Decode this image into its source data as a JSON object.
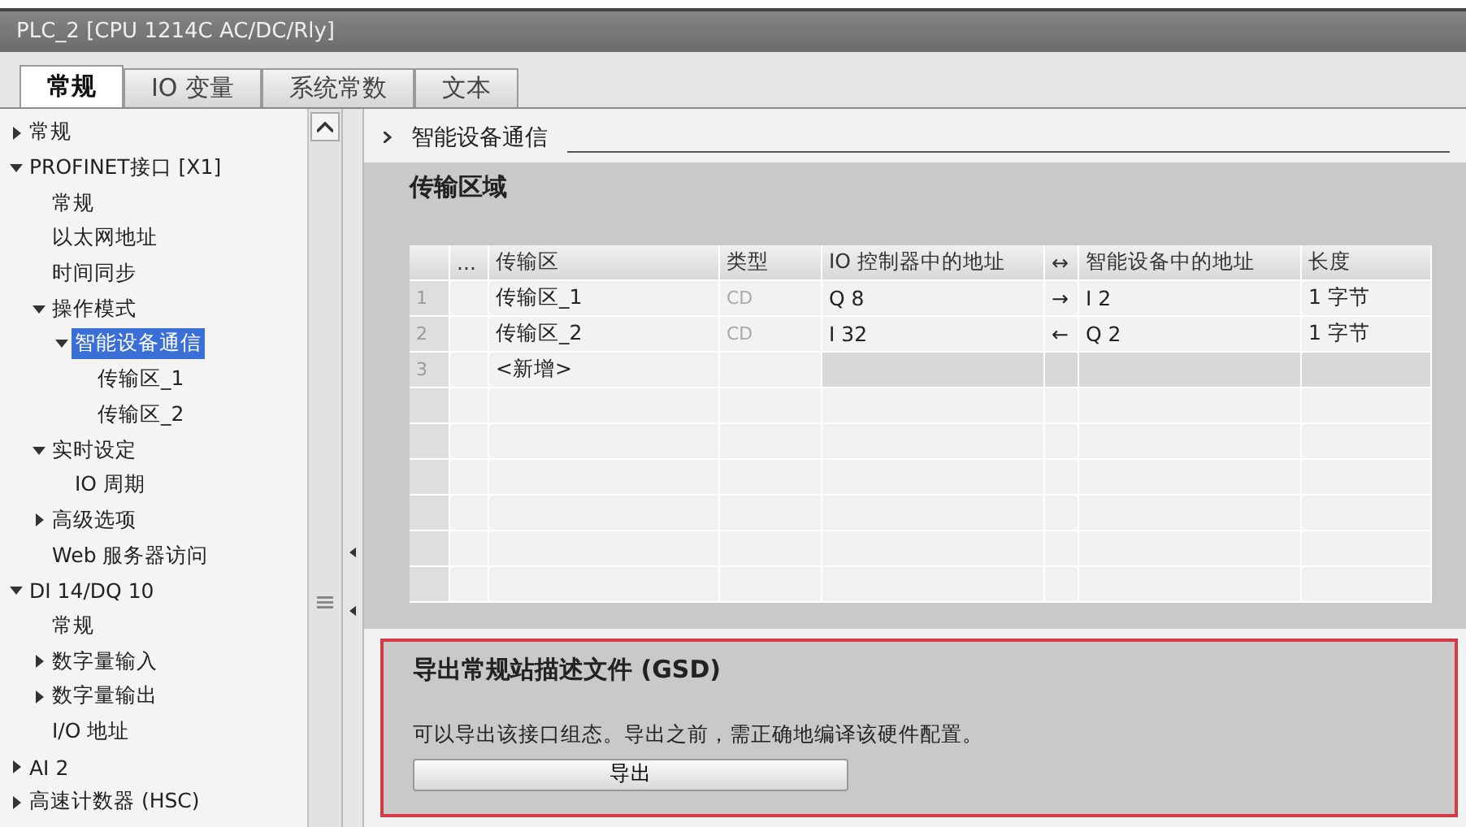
{
  "window": {
    "title": "PLC_2 [CPU 1214C AC/DC/Rly]"
  },
  "tabs": [
    {
      "label": "常规",
      "selected": true
    },
    {
      "label": "IO 变量",
      "selected": false
    },
    {
      "label": "系统常数",
      "selected": false
    },
    {
      "label": "文本",
      "selected": false
    }
  ],
  "sidebar": {
    "items": [
      {
        "label": "常规",
        "kind": "folder",
        "expanded": false,
        "selected": false
      },
      {
        "label": "PROFINET接口 [X1]",
        "kind": "folder",
        "expanded": true,
        "selected": false,
        "children": [
          {
            "label": "常规",
            "kind": "leaf",
            "selected": false
          },
          {
            "label": "以太网地址",
            "kind": "leaf",
            "selected": false
          },
          {
            "label": "时间同步",
            "kind": "leaf",
            "selected": false
          },
          {
            "label": "操作模式",
            "kind": "folder",
            "expanded": true,
            "selected": false,
            "children": [
              {
                "label": "智能设备通信",
                "kind": "folder",
                "expanded": true,
                "selected": true,
                "children": [
                  {
                    "label": "传输区_1",
                    "kind": "leaf",
                    "selected": false
                  },
                  {
                    "label": "传输区_2",
                    "kind": "leaf",
                    "selected": false
                  }
                ]
              }
            ]
          },
          {
            "label": "实时设定",
            "kind": "folder",
            "expanded": true,
            "selected": false,
            "children": [
              {
                "label": "IO 周期",
                "kind": "leaf",
                "selected": false
              }
            ]
          },
          {
            "label": "高级选项",
            "kind": "folder",
            "expanded": false,
            "selected": false
          },
          {
            "label": "Web 服务器访问",
            "kind": "leaf",
            "selected": false
          }
        ]
      },
      {
        "label": "DI 14/DQ 10",
        "kind": "folder",
        "expanded": true,
        "selected": false,
        "children": [
          {
            "label": "常规",
            "kind": "leaf",
            "selected": false
          },
          {
            "label": "数字量输入",
            "kind": "folder",
            "expanded": false,
            "selected": false
          },
          {
            "label": "数字量输出",
            "kind": "folder",
            "expanded": false,
            "selected": false
          },
          {
            "label": "I/O 地址",
            "kind": "leaf",
            "selected": false
          }
        ]
      },
      {
        "label": "AI 2",
        "kind": "folder",
        "expanded": false,
        "selected": false
      },
      {
        "label": "高速计数器 (HSC)",
        "kind": "folder",
        "expanded": false,
        "selected": false
      }
    ]
  },
  "section": {
    "title": "智能设备通信"
  },
  "transfer_area": {
    "title": "传输区域",
    "columns": [
      "...",
      "传输区",
      "类型",
      "IO 控制器中的地址",
      "↔",
      "智能设备中的地址",
      "长度"
    ],
    "rows": [
      {
        "index": "1",
        "cells": [
          "",
          "传输区_1",
          "CD",
          "Q 8",
          "→",
          "I 2",
          "1 字节"
        ],
        "kind": "entry"
      },
      {
        "index": "2",
        "cells": [
          "",
          "传输区_2",
          "CD",
          "I 32",
          "←",
          "Q 2",
          "1 字节"
        ],
        "kind": "entry"
      },
      {
        "index": "3",
        "cells": [
          "",
          "<新增>",
          "",
          "",
          "",
          "",
          ""
        ],
        "kind": "new"
      }
    ]
  },
  "export": {
    "title": "导出常规站描述文件 (GSD)",
    "description": "可以导出该接口组态。导出之前，需正确地编译该硬件配置。",
    "button": "导出"
  }
}
